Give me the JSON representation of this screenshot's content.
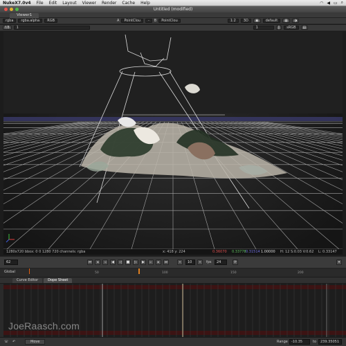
{
  "menubar": {
    "app_name": "NukeX7.0v4",
    "items": [
      "File",
      "Edit",
      "Layout",
      "Viewer",
      "Render",
      "Cache",
      "Help"
    ]
  },
  "window": {
    "title": "Untitled (modified)"
  },
  "viewer": {
    "tab_label": "Viewer1"
  },
  "controls_row1": {
    "channels": "rgba",
    "channel_alpha": "rgba.alpha",
    "display": "RGB",
    "input_a_label": "A",
    "input_a": "PointClou",
    "input_a_op": "-",
    "input_b_label": "B",
    "input_b": "PointClou",
    "proxy": "1:2",
    "view_mode": "3D",
    "lut": "default"
  },
  "controls_row2": {
    "frame_field": "f/8",
    "frame_value": "1",
    "zoom_value": "1",
    "colorspace": "sRGB"
  },
  "info_bar": {
    "format": "1280x720  bbox: 0 0 1280 720 channels: rgba",
    "coords": "x: 418 y: 224",
    "r": "0.36070",
    "g": "0.33778",
    "b": "0.31514",
    "a": "1.00000",
    "h": "H: 12 S:0.03 V:0.62",
    "l": "L: 0.33147"
  },
  "transport": {
    "current_frame": "62",
    "step": "10",
    "fps_label": "fps",
    "fps_value": "24",
    "global_label": "Global"
  },
  "ruler": {
    "labels": [
      "50",
      "100",
      "150",
      "200"
    ]
  },
  "dope_tabs": {
    "curve_editor": "Curve Editor",
    "dope_sheet": "Dope Sheet"
  },
  "bottom": {
    "move_label": "Move",
    "range_label": "Range",
    "range_start": "-10.35",
    "to_label": "to",
    "range_end": "239.35051"
  },
  "watermark": "JoeRaasch.com",
  "colors": {
    "accent": "#e06010",
    "viewport_bg": "#202020",
    "grid": "#c8c8c8",
    "dopesheet_red": "#3a1414"
  }
}
